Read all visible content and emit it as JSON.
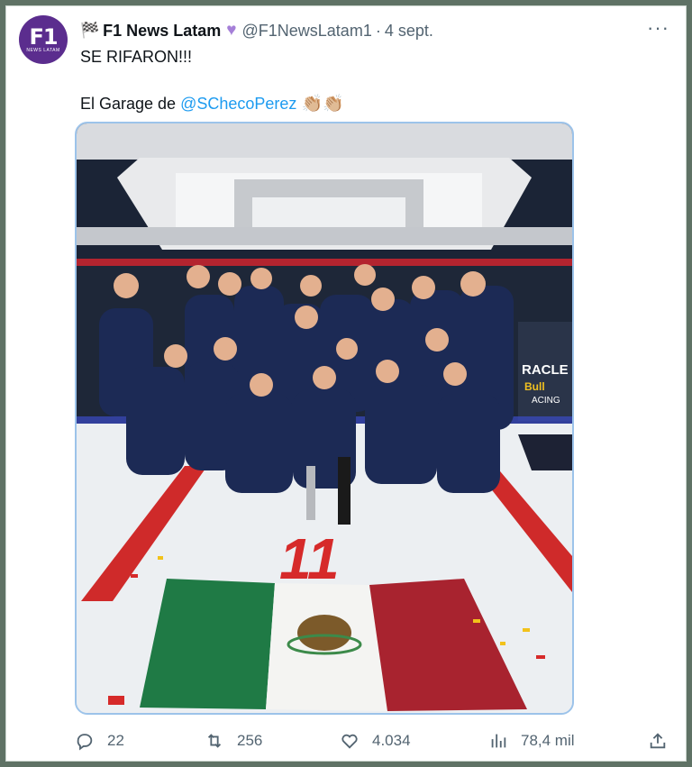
{
  "tweet": {
    "avatar": {
      "main": "F1",
      "sub": "NEWS LATAM"
    },
    "display_name": "F1 News Latam",
    "handle": "@F1NewsLatam1",
    "separator": "·",
    "date": "4 sept.",
    "icons": {
      "flag": "checkered-flag-icon",
      "badge": "purple-heart-icon",
      "more": "more-options-icon"
    },
    "text_line1": "SE RIFARON!!!",
    "text_line2_prefix": "El Garage de",
    "mention": "@SChecoPerez",
    "emoji": "👏🏼👏🏼"
  },
  "media": {
    "description_kind": "photo",
    "floor_number": "11",
    "sign_text": "RACLE",
    "sign_text2": "Bull",
    "sign_text3": "ACING"
  },
  "actions": {
    "replies": "22",
    "retweets": "256",
    "likes": "4.034",
    "views": "78,4 mil"
  },
  "colors": {
    "accent": "#1d9bf0",
    "avatar": "#5b2d8e",
    "heart": "#a57fd8",
    "muted": "#536471"
  }
}
